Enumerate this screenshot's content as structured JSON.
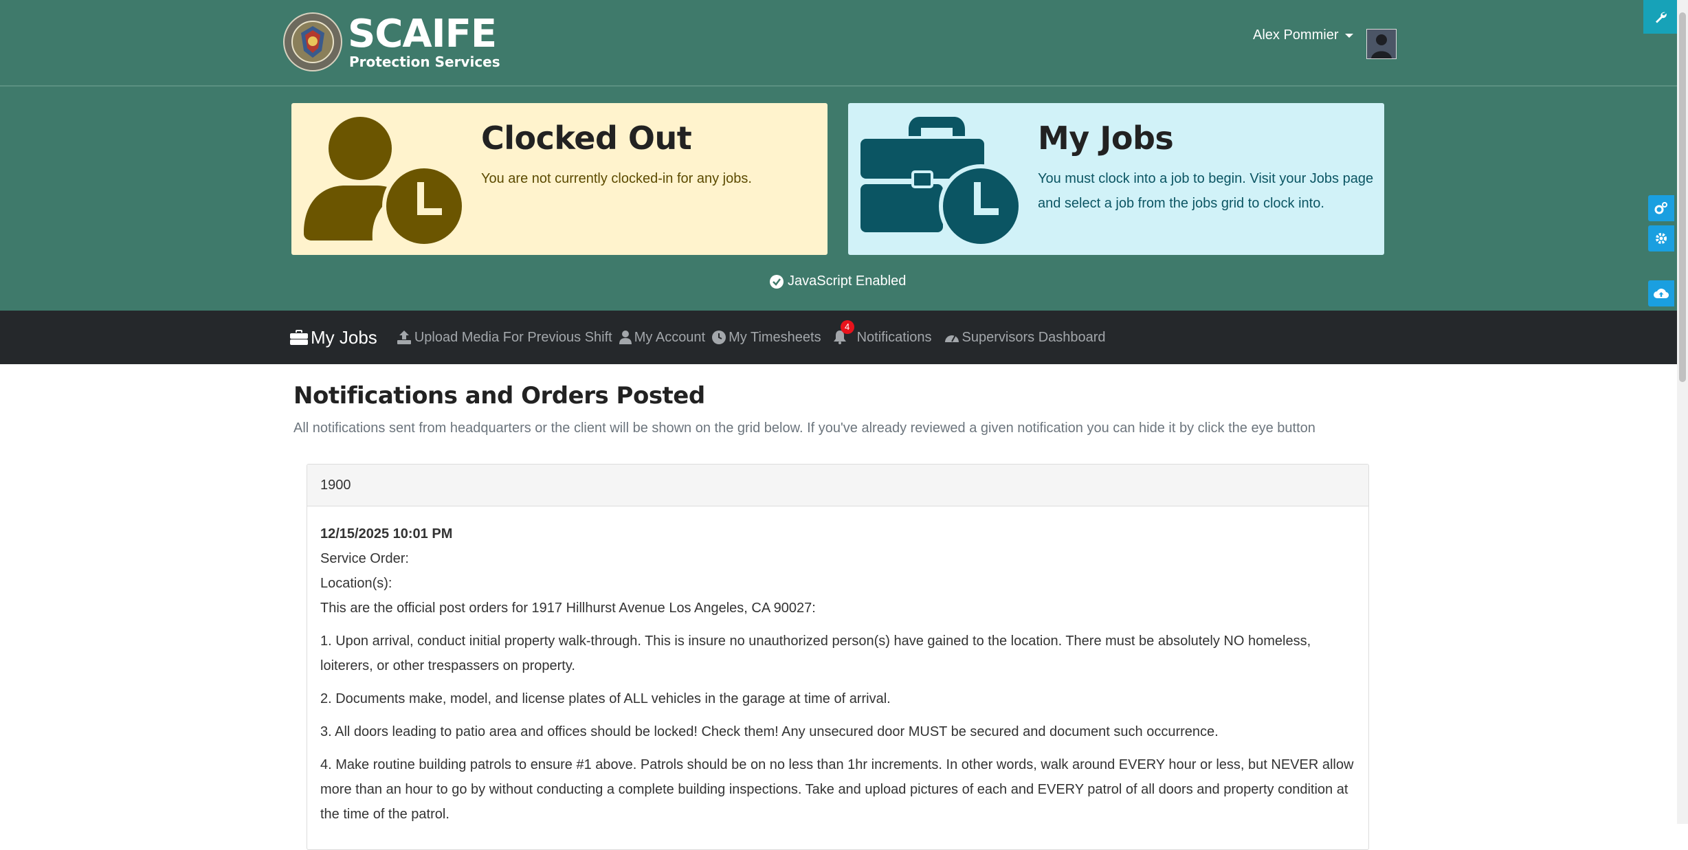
{
  "header": {
    "logo_main": "SCAIFE",
    "logo_sub": "Protection Services",
    "user_name": "Alex Pommier"
  },
  "status": {
    "clock_title": "Clocked Out",
    "clock_text": "You are not currently clocked-in for any jobs.",
    "jobs_title": "My Jobs",
    "jobs_text": "You must clock into a job to begin. Visit your Jobs page and select a job from the jobs grid to clock into.",
    "js_status": "JavaScript Enabled"
  },
  "nav": {
    "brand": "My Jobs",
    "items": [
      {
        "label": "Upload Media For Previous Shift",
        "icon": "upload-icon"
      },
      {
        "label": "My Account",
        "icon": "user-icon"
      },
      {
        "label": "My Timesheets",
        "icon": "clock-icon"
      },
      {
        "label": "Notifications",
        "icon": "bell-icon"
      },
      {
        "label": "Supervisors Dashboard",
        "icon": "dashboard-icon"
      }
    ],
    "notification_count": "4"
  },
  "page": {
    "title": "Notifications and Orders Posted",
    "description": "All notifications sent from headquarters or the client will be shown on the grid below. If you've already reviewed a given notification you can hide it by click the eye button"
  },
  "notification": {
    "header": "1900",
    "date": "12/15/2025 10:01 PM",
    "service_order": "Service Order:",
    "locations": "Location(s):",
    "intro": "This are the official post orders for 1917 Hillhurst Avenue Los Angeles, CA 90027:",
    "orders": [
      "1. Upon arrival, conduct initial property walk-through. This is insure no unauthorized person(s) have gained to the location.  There must be absolutely NO homeless, loiterers, or other trespassers on property.",
      "2. Documents make, model, and license plates of ALL vehicles in the garage at time of arrival.",
      "3. All doors leading to patio area and offices should be locked! Check them! Any unsecured door MUST be secured and document such occurrence.",
      "4. Make routine building patrols to ensure #1 above.  Patrols should be on no less than 1hr increments.  In other words, walk around EVERY hour or less, but NEVER allow more than an hour to go by without conducting a complete building inspections. Take and upload pictures of each and EVERY patrol of all doors and property condition at the time of the patrol."
    ]
  },
  "colors": {
    "header_bg": "#3f7a6b",
    "nav_bg": "#25282b",
    "clock_card_bg": "#fff3cd",
    "jobs_card_bg": "#d1f2f8",
    "badge": "#e8131c",
    "side_button": "#1a9fe0"
  }
}
